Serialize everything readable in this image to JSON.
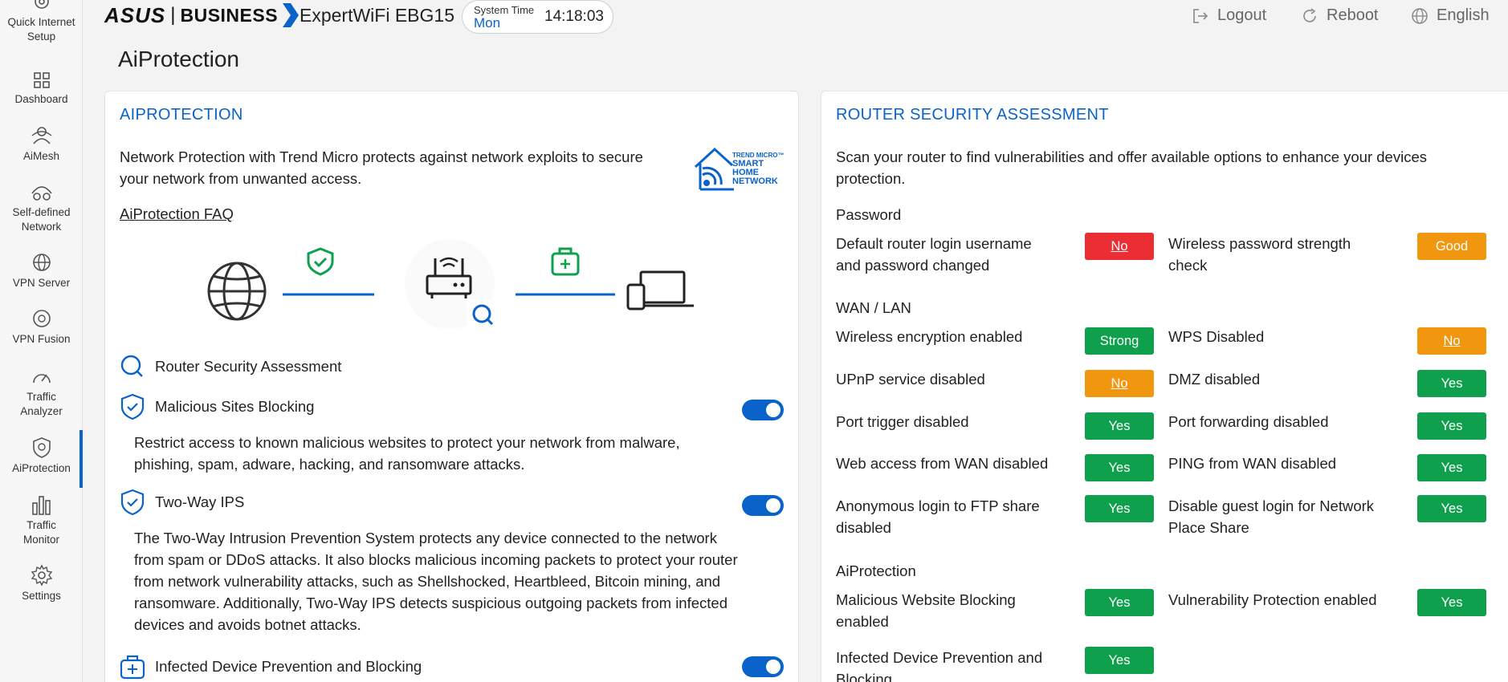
{
  "sidebar": {
    "items": [
      {
        "label": "Quick Internet Setup",
        "icon": "quick-setup-icon"
      },
      {
        "label": "Dashboard",
        "icon": "dashboard-icon"
      },
      {
        "label": "AiMesh",
        "icon": "aimesh-icon"
      },
      {
        "label": "Self-defined Network",
        "icon": "network-icon"
      },
      {
        "label": "VPN Server",
        "icon": "vpn-server-icon"
      },
      {
        "label": "VPN Fusion",
        "icon": "vpn-fusion-icon"
      },
      {
        "label": "Traffic Analyzer",
        "icon": "traffic-analyzer-icon"
      },
      {
        "label": "AiProtection",
        "icon": "aiprotection-icon",
        "active": true
      },
      {
        "label": "Traffic Monitor",
        "icon": "traffic-monitor-icon"
      },
      {
        "label": "Settings",
        "icon": "settings-icon"
      }
    ],
    "accent": "#0a63c9"
  },
  "header": {
    "brand": "ASUS",
    "separator": "|",
    "division": "BUSINESS",
    "model": "ExpertWiFi EBG15",
    "system_time_label": "System Time",
    "day": "Mon",
    "time": "14:18:03",
    "logout": "Logout",
    "reboot": "Reboot",
    "language": "English"
  },
  "page_title": "AiProtection",
  "aiprotection": {
    "title": "AIPROTECTION",
    "description": "Network Protection with Trend Micro protects against network exploits to secure your network from unwanted access.",
    "trend_logo": [
      "TREND MICRO™",
      "SMART",
      "HOME",
      "NETWORK"
    ],
    "faq": "AiProtection FAQ",
    "features": {
      "assessment": "Router Security Assessment",
      "malicious": {
        "label": "Malicious Sites Blocking",
        "enabled": true,
        "desc_1": "Restrict access to known malicious websites to protect your network from malware,",
        "desc_2": "phishing, spam, adware, hacking, and ransomware attacks."
      },
      "ips": {
        "label": "Two-Way IPS",
        "enabled": true,
        "desc_1": "The Two-Way Intrusion Prevention System protects any device connected to the network",
        "desc_2": "from spam or DDoS attacks. It also blocks malicious incoming packets to protect your router",
        "desc_3": "from network vulnerability attacks, such as Shellshocked, Heartbleed, Bitcoin mining, and",
        "desc_4": "ransomware. Additionally, Two-Way IPS detects suspicious outgoing packets from infected",
        "desc_5": "devices and avoids botnet attacks."
      },
      "infected": {
        "label": "Infected Device Prevention and Blocking",
        "enabled": true
      }
    }
  },
  "assessment": {
    "title": "ROUTER SECURITY ASSESSMENT",
    "desc_1": "Scan your router to find vulnerabilities and offer available options to enhance your devices",
    "desc_2": "protection.",
    "sections": {
      "password": "Password",
      "wanlan": "WAN / LAN",
      "aiprot": "AiProtection"
    },
    "rows": {
      "default_login": {
        "l1": "Default router login username",
        "l2": "and password changed",
        "status": "No"
      },
      "wifi_strength": {
        "l1": "Wireless password strength",
        "l2": "check",
        "status": "Good"
      },
      "wifi_enc": {
        "l1": "Wireless encryption enabled",
        "status": "Strong"
      },
      "wps": {
        "l1": "WPS Disabled",
        "status": "No"
      },
      "upnp": {
        "l1": "UPnP service disabled",
        "status": "No"
      },
      "dmz": {
        "l1": "DMZ disabled",
        "status": "Yes"
      },
      "port_trigger": {
        "l1": "Port trigger disabled",
        "status": "Yes"
      },
      "port_fwd": {
        "l1": "Port forwarding disabled",
        "status": "Yes"
      },
      "web_wan": {
        "l1": "Web access from WAN disabled",
        "status": "Yes"
      },
      "ping_wan": {
        "l1": "PING from WAN disabled",
        "status": "Yes"
      },
      "ftp_anon": {
        "l1": "Anonymous login to FTP share",
        "l2": "disabled",
        "status": "Yes"
      },
      "guest_share": {
        "l1": "Disable guest login for Network",
        "l2": "Place Share",
        "status": "Yes"
      },
      "mal_block": {
        "l1": "Malicious Website Blocking",
        "l2": "enabled",
        "status": "Yes"
      },
      "vuln_prot": {
        "l1": "Vulnerability Protection enabled",
        "status": "Yes"
      },
      "infected_block": {
        "l1": "Infected Device Prevention and",
        "l2": "Blocking",
        "status": "Yes"
      }
    },
    "colors": {
      "good": "#0fa04d",
      "bad": "#ea2e34",
      "warn": "#f0960f"
    }
  }
}
